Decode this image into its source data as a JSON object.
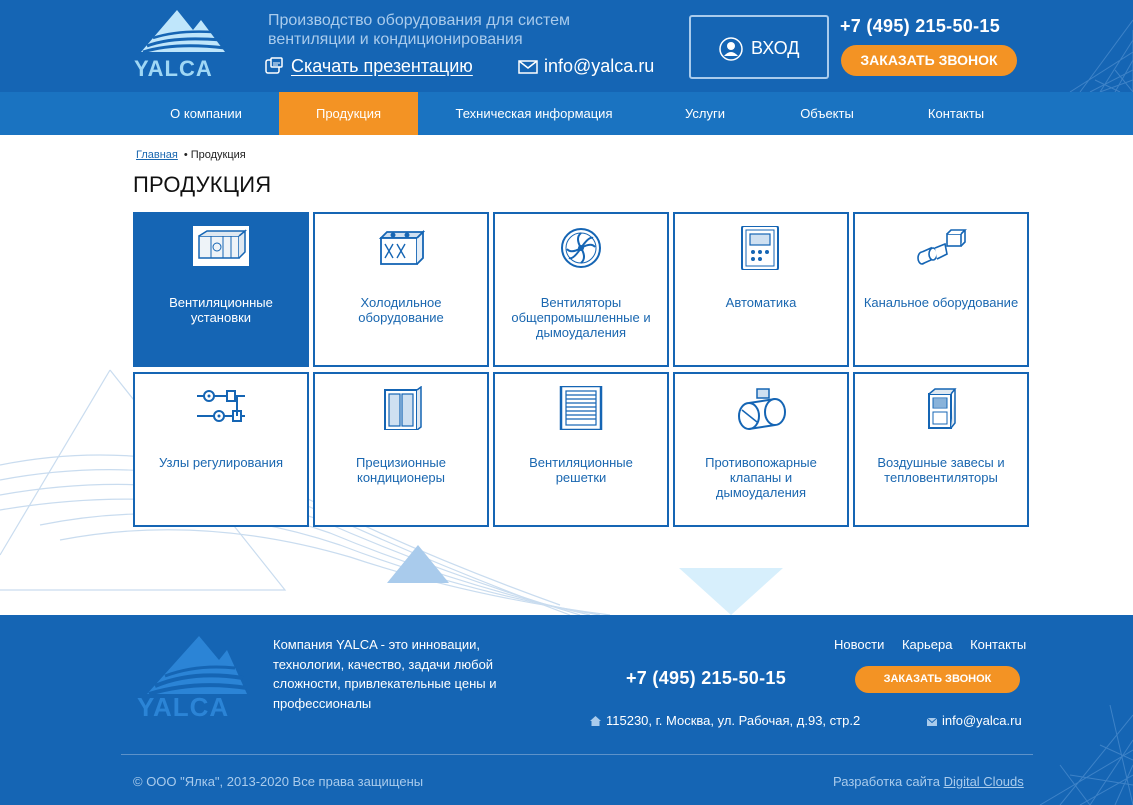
{
  "header": {
    "logo_text": "YALCA",
    "tagline": "Производство оборудования для систем вентиляции и кондиционирования",
    "download_label": "Скачать презентацию",
    "email": "info@yalca.ru",
    "login_label": "ВХОД",
    "phone": "+7 (495) 215-50-15",
    "call_label": "ЗАКАЗАТЬ ЗВОНОК"
  },
  "nav": {
    "items": [
      {
        "label": "О компании"
      },
      {
        "label": "Продукция",
        "active": true
      },
      {
        "label": "Техническая информация"
      },
      {
        "label": "Услуги"
      },
      {
        "label": "Объекты"
      },
      {
        "label": "Контакты"
      }
    ]
  },
  "breadcrumb": {
    "home": "Главная",
    "separator": "•",
    "current": "Продукция"
  },
  "page_title": "ПРОДУКЦИЯ",
  "categories": [
    {
      "label": "Вентиляционные установки",
      "icon": "ventilation-unit-icon",
      "active": true
    },
    {
      "label": "Холодильное оборудование",
      "icon": "chiller-icon"
    },
    {
      "label": "Вентиляторы общепромышленные и дымоудаления",
      "icon": "fan-icon"
    },
    {
      "label": "Автоматика",
      "icon": "control-panel-icon"
    },
    {
      "label": "Канальное оборудование",
      "icon": "duct-equipment-icon"
    },
    {
      "label": "Узлы регулирования",
      "icon": "mixing-unit-icon"
    },
    {
      "label": "Прецизионные кондиционеры",
      "icon": "precision-ac-icon"
    },
    {
      "label": "Вентиляционные решетки",
      "icon": "grille-icon"
    },
    {
      "label": "Противопожарные клапаны и дымоудаления",
      "icon": "fire-damper-icon"
    },
    {
      "label": "Воздушные завесы и тепловентиляторы",
      "icon": "air-curtain-icon"
    }
  ],
  "footer": {
    "about": "Компания YALCA - это инновации, технологии, качество, задачи любой сложности, привлекательные цены и профессионалы",
    "phone": "+7 (495) 215-50-15",
    "links": [
      "Новости",
      "Карьера",
      "Контакты"
    ],
    "call_label": "ЗАКАЗАТЬ ЗВОНОК",
    "address": "115230, г. Москва, ул. Рабочая, д.93, стр.2",
    "email": "info@yalca.ru",
    "copyright": "© ООО \"Ялка\", 2013-2020 Все права защищены",
    "dev_prefix": "Разработка сайта",
    "dev_link": "Digital Clouds"
  },
  "colors": {
    "brand_blue": "#1565b4",
    "nav_blue": "#1a73c1",
    "accent_orange": "#f39324",
    "link_blue": "#1a67b0"
  }
}
